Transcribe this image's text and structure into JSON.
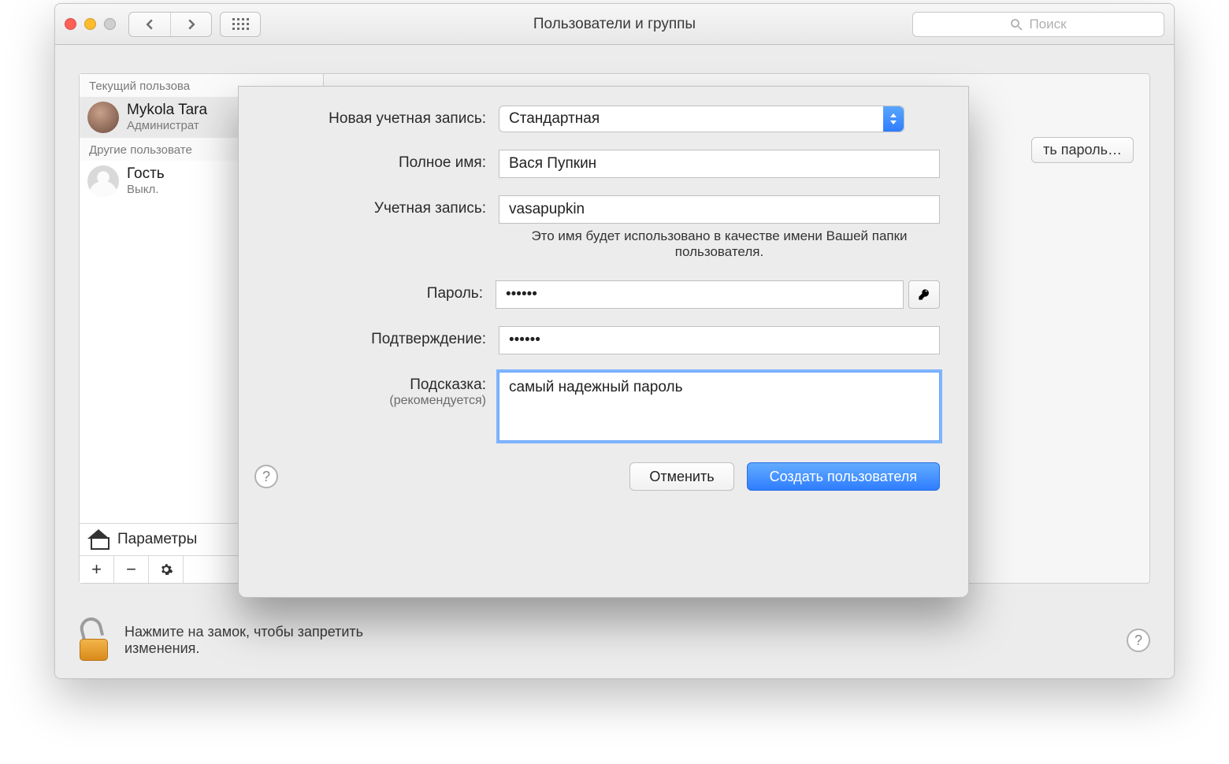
{
  "window": {
    "title": "Пользователи и группы",
    "search_placeholder": "Поиск"
  },
  "sidebar": {
    "current_label": "Текущий пользова",
    "current_user": {
      "name": "Mykola Tara",
      "role": "Администрат"
    },
    "others_label": "Другие пользовате",
    "guest": {
      "name": "Гость",
      "status": "Выкл."
    },
    "login_options": "Параметры"
  },
  "pane": {
    "change_password": "ть пароль…"
  },
  "lockrow": {
    "line1": "Нажмите на замок, чтобы запретить",
    "line2": "изменения."
  },
  "sheet": {
    "new_account_label": "Новая учетная запись:",
    "account_type": "Стандартная",
    "fullname_label": "Полное имя:",
    "fullname_value": "Вася Пупкин",
    "account_label": "Учетная запись:",
    "account_value": "vasapupkin",
    "account_hint": "Это имя будет использовано в качестве имени Вашей папки пользователя.",
    "password_label": "Пароль:",
    "password_value": "••••••",
    "confirm_label": "Подтверждение:",
    "confirm_value": "••••••",
    "hint_label": "Подсказка:",
    "hint_sub": "(рекомендуется)",
    "hint_value": "самый надежный пароль",
    "cancel": "Отменить",
    "create": "Создать пользователя"
  }
}
